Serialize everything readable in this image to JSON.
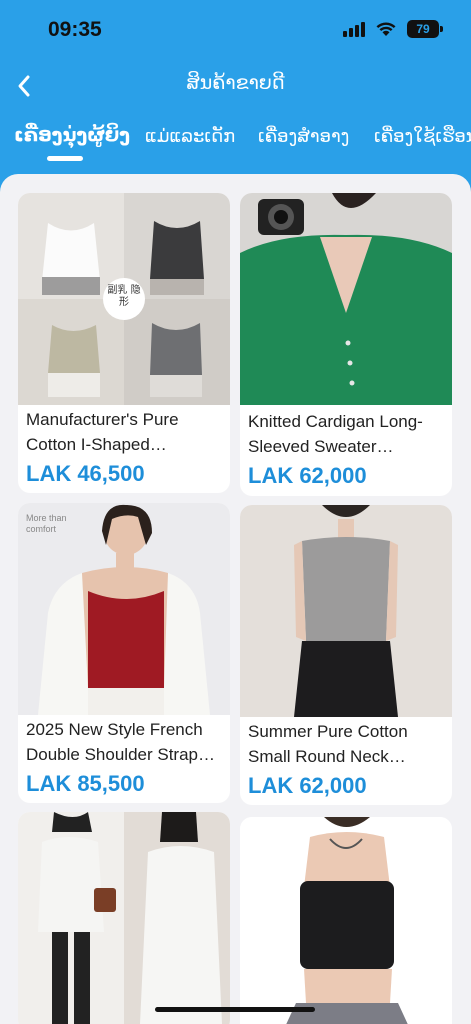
{
  "status_bar": {
    "time": "09:35",
    "battery": "79"
  },
  "nav": {
    "title": "ສິນຄ້າຂາຍດີ"
  },
  "tabs": [
    {
      "label": "ເຄື່ອງນຸ່ງຜູ້ຍິງ",
      "active": true
    },
    {
      "label": "ແມ່ແລະເດັກ",
      "active": false
    },
    {
      "label": "ເຄື່ອງສຳອາງ",
      "active": false
    },
    {
      "label": "ເຄື່ອງໃຊ້ເຮືອນ",
      "active": false
    }
  ],
  "products": [
    {
      "title": "Manufacturer's Pure Cotton I-Shaped…",
      "price": "LAK 46,500",
      "image": "white-gray-tank-tops-photo",
      "image_caption": "副乳 隐形"
    },
    {
      "title": "Knitted Cardigan Long-Sleeved Sweater…",
      "price": "LAK 62,000",
      "image": "green-cardigan-photo"
    },
    {
      "title": "2025 New Style French Double Shoulder Strap…",
      "price": "LAK 85,500",
      "image": "red-camisole-photo",
      "image_caption": "More than comfort"
    },
    {
      "title": "Summer Pure Cotton Small Round Neck…",
      "price": "LAK 62,000",
      "image": "gray-tank-top-photo"
    },
    {
      "title": "",
      "price": "",
      "image": "white-sweatshirt-photo"
    },
    {
      "title": "",
      "price": "",
      "image": "black-tube-top-photo"
    }
  ],
  "colors": {
    "primary": "#2aa0e8",
    "price": "#1e8ed9",
    "background": "#f2f2f5"
  }
}
